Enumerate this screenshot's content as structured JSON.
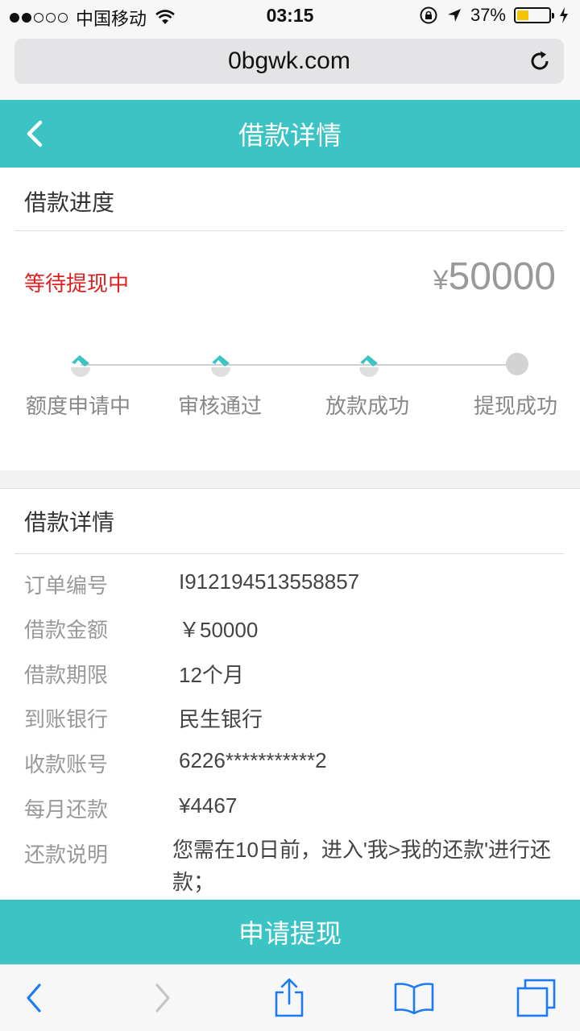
{
  "status_bar": {
    "carrier": "中国移动",
    "time": "03:15",
    "battery": "37%",
    "battery_level": 0.37
  },
  "browser": {
    "url": "0bgwk.com"
  },
  "header": {
    "title": "借款详情"
  },
  "progress": {
    "section_title": "借款进度",
    "status": "等待提现中",
    "currency": "¥",
    "amount": "50000",
    "steps": [
      {
        "label": "额度申请中",
        "done": true
      },
      {
        "label": "审核通过",
        "done": true
      },
      {
        "label": "放款成功",
        "done": true
      },
      {
        "label": "提现成功",
        "done": false
      }
    ]
  },
  "details": {
    "section_title": "借款详情",
    "rows": [
      {
        "label": "订单编号",
        "value": "I912194513558857"
      },
      {
        "label": "借款金额",
        "value": "￥50000"
      },
      {
        "label": "借款期限",
        "value": "12个月"
      },
      {
        "label": "到账银行",
        "value": "民生银行"
      },
      {
        "label": "收款账号",
        "value": "6226***********2"
      },
      {
        "label": "每月还款",
        "value": "¥4467"
      },
      {
        "label": "还款说明",
        "value": "您需在10日前，进入'我>我的还款'进行还款；"
      }
    ]
  },
  "action": {
    "apply_label": "申请提现"
  },
  "colors": {
    "accent": "#3cc3c3",
    "status_red": "#e02020"
  }
}
